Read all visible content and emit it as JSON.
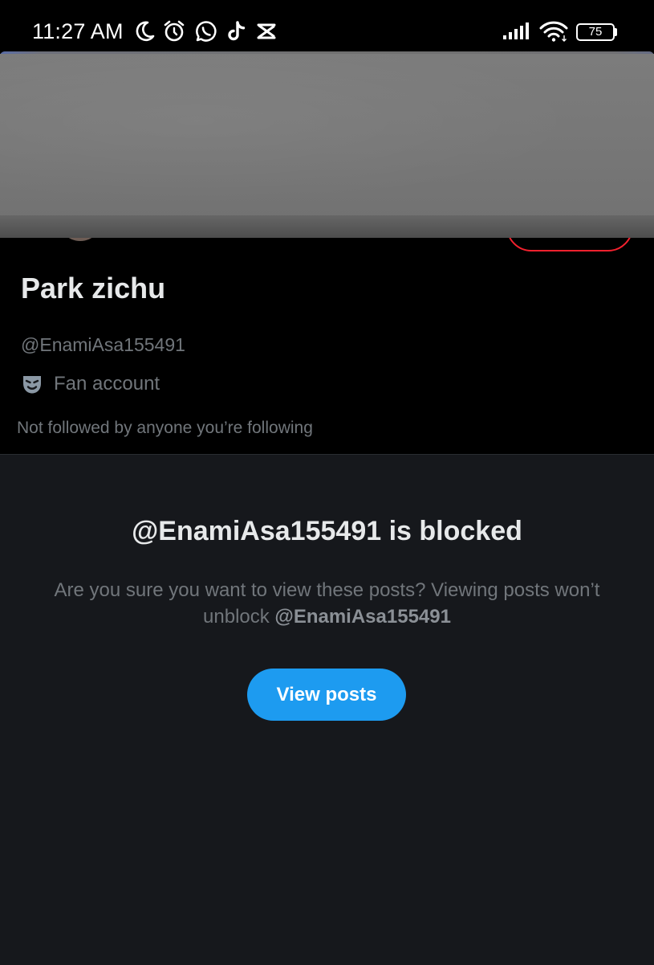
{
  "status_bar": {
    "time": "11:27 AM",
    "battery_level": "75",
    "left_icons": [
      "moon-icon",
      "alarm-icon",
      "whatsapp-icon",
      "tiktok-icon",
      "capcut-icon"
    ],
    "right_icons": [
      "cellular-signal-icon",
      "wifi-icon",
      "battery-icon"
    ]
  },
  "profile": {
    "display_name": "Park zichu",
    "handle": "@EnamiAsa155491",
    "category_icon": "theater-mask-icon",
    "category": "Fan account",
    "followers_note": "Not followed by anyone you’re following"
  },
  "blocked": {
    "title": "@EnamiAsa155491 is blocked",
    "description_prefix": "Are you sure you want to view these posts? Viewing posts won’t unblock ",
    "description_handle": "@EnamiAsa155491",
    "button_label": "View posts"
  },
  "colors": {
    "background": "#000000",
    "panel_background": "#16181c",
    "primary_text": "#e7e9ea",
    "secondary_text": "#71767b",
    "accent_blue": "#1d9bf0",
    "blocked_red": "#f4212e"
  }
}
